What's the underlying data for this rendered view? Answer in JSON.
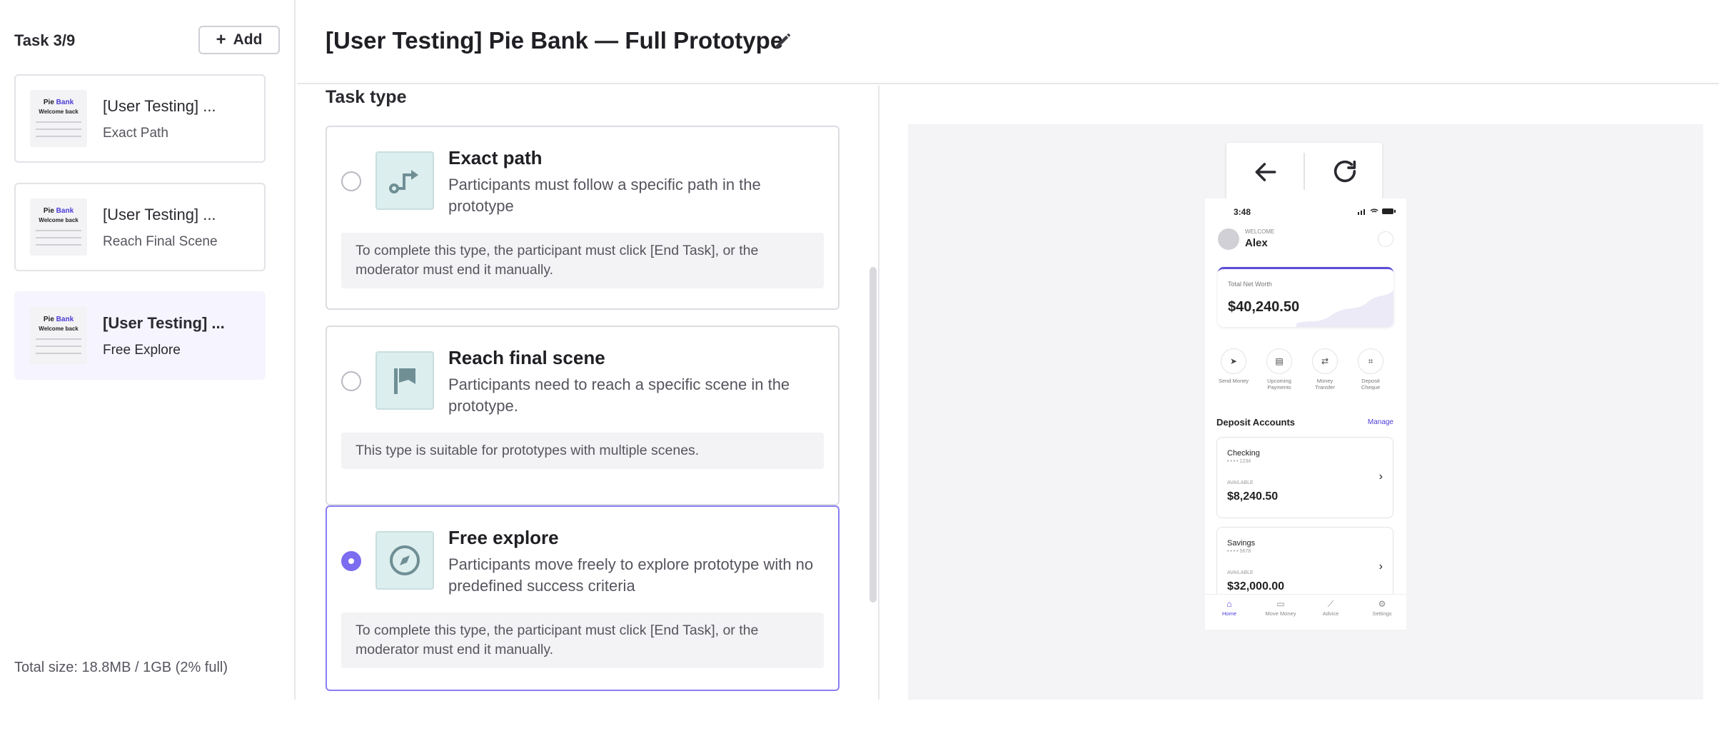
{
  "sidebar": {
    "task_count": "Task 3/9",
    "add_label": "Add",
    "tasks": [
      {
        "title": "[User Testing] ...",
        "subtitle": "Exact Path"
      },
      {
        "title": "[User Testing] ...",
        "subtitle": "Reach Final Scene"
      },
      {
        "title": "[User Testing] ...",
        "subtitle": "Free Explore"
      }
    ],
    "thumb": {
      "logo_a": "Pie",
      "logo_b": "Bank",
      "welcome": "Welcome back"
    },
    "total_size": "Total size: 18.8MB / 1GB (2% full)"
  },
  "header": {
    "title": "[User Testing] Pie Bank — Full Prototype"
  },
  "task_type": {
    "label": "Task type",
    "selected": "free-explore",
    "options": [
      {
        "title": "Exact path",
        "description": "Participants must follow a specific path in the prototype",
        "note": "To complete this type, the participant must click [End Task], or the moderator must end it manually."
      },
      {
        "title": "Reach final scene",
        "description": "Participants need to reach a specific scene in the prototype.",
        "note": "This type is suitable for prototypes with multiple scenes."
      },
      {
        "title": "Free explore",
        "description": "Participants move freely to explore prototype with no predefined success criteria",
        "note": "To complete this type, the participant must click [End Task], or the moderator must end it manually."
      }
    ]
  },
  "prototype": {
    "time": "3:48",
    "welcome": "WELCOME",
    "name": "Alex",
    "net_worth_label": "Total Net Worth",
    "net_worth_value": "$40,240.50",
    "actions": [
      {
        "label": "Send Money",
        "icon": "send-icon"
      },
      {
        "label": "Upcoming Payments",
        "icon": "bill-icon"
      },
      {
        "label": "Money Transfer",
        "icon": "transfer-icon"
      },
      {
        "label": "Deposit Cheque",
        "icon": "scan-icon"
      }
    ],
    "deposit_title": "Deposit Accounts",
    "manage": "Manage",
    "accounts": [
      {
        "name": "Checking",
        "number": "• • • • 1234",
        "available": "AVAILABLE",
        "balance": "$8,240.50"
      },
      {
        "name": "Savings",
        "number": "• • • • 5678",
        "available": "AVAILABLE",
        "balance": "$32,000.00"
      }
    ],
    "tabs": [
      {
        "label": "Home",
        "icon": "home-icon"
      },
      {
        "label": "Move Money",
        "icon": "money-icon"
      },
      {
        "label": "Advice",
        "icon": "chart-icon"
      },
      {
        "label": "Settings",
        "icon": "gear-icon"
      }
    ]
  },
  "colors": {
    "accent": "#7c6cf0",
    "selected_bg": "#f6f4fe",
    "icon_tile": "#ddeeee",
    "brand": "#4b3cd6"
  }
}
